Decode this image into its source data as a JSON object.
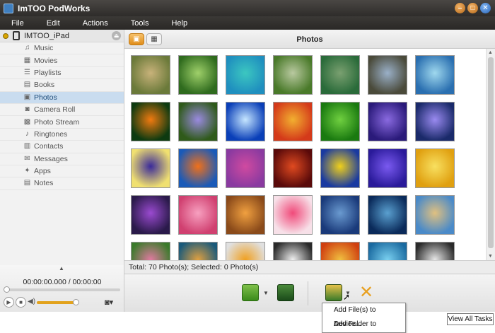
{
  "app": {
    "title": "ImTOO PodWorks"
  },
  "menu": [
    "File",
    "Edit",
    "Actions",
    "Tools",
    "Help"
  ],
  "sidebar": {
    "device_name": "IMTOO_iPad",
    "items": [
      {
        "label": "Music",
        "icon": "music-note-icon"
      },
      {
        "label": "Movies",
        "icon": "film-icon"
      },
      {
        "label": "Playlists",
        "icon": "playlist-icon"
      },
      {
        "label": "Books",
        "icon": "book-icon"
      },
      {
        "label": "Photos",
        "icon": "photo-icon",
        "active": true
      },
      {
        "label": "Camera Roll",
        "icon": "camera-icon"
      },
      {
        "label": "Photo Stream",
        "icon": "photo-stream-icon"
      },
      {
        "label": "Ringtones",
        "icon": "bell-icon"
      },
      {
        "label": "Contacts",
        "icon": "contacts-icon"
      },
      {
        "label": "Messages",
        "icon": "message-icon"
      },
      {
        "label": "Apps",
        "icon": "apps-icon"
      },
      {
        "label": "Notes",
        "icon": "notes-icon"
      }
    ]
  },
  "player": {
    "time": "00:00:00.000 / 00:00:00"
  },
  "main": {
    "title": "Photos",
    "status": "Total: 70 Photo(s); Selected: 0 Photo(s)"
  },
  "photos": [
    {
      "c1": "#6b7a3a",
      "c2": "#c8b27a"
    },
    {
      "c1": "#2f6b1e",
      "c2": "#9fd06a"
    },
    {
      "c1": "#1f8fbf",
      "c2": "#3cc7c0"
    },
    {
      "c1": "#4a7a2a",
      "c2": "#b9c9a0"
    },
    {
      "c1": "#2a6b3a",
      "c2": "#7aa070"
    },
    {
      "c1": "#4a4a3a",
      "c2": "#9ab0c8"
    },
    {
      "c1": "#2a6fb0",
      "c2": "#9fd8ee"
    },
    {
      "c1": "#0d3a10",
      "c2": "#f07a10"
    },
    {
      "c1": "#2f5a1a",
      "c2": "#9a8ae0"
    },
    {
      "c1": "#0a3fb8",
      "c2": "#c6e6ff"
    },
    {
      "c1": "#d43a1a",
      "c2": "#f2b030"
    },
    {
      "c1": "#1a7a10",
      "c2": "#70d040"
    },
    {
      "c1": "#2a1a7a",
      "c2": "#8a6ae0"
    },
    {
      "c1": "#1a2a6a",
      "c2": "#9a8af0"
    },
    {
      "c1": "#f0e070",
      "c2": "#3a2a9a"
    },
    {
      "c1": "#1a5ab8",
      "c2": "#f0701a"
    },
    {
      "c1": "#8a3aa0",
      "c2": "#d04aa0"
    },
    {
      "c1": "#5a0a0a",
      "c2": "#e04a20"
    },
    {
      "c1": "#1a3aa0",
      "c2": "#f0d01a"
    },
    {
      "c1": "#2a1a9a",
      "c2": "#7a5af0"
    },
    {
      "c1": "#e0a010",
      "c2": "#f8e060"
    },
    {
      "c1": "#2a1a4a",
      "c2": "#9a4ad0"
    },
    {
      "c1": "#d04070",
      "c2": "#f7a0c0"
    },
    {
      "c1": "#8a4a1a",
      "c2": "#f0a040"
    },
    {
      "c1": "#f7e0e8",
      "c2": "#f04a7a"
    },
    {
      "c1": "#1a3a7a",
      "c2": "#6a9ad0"
    },
    {
      "c1": "#0a2a5a",
      "c2": "#5aa0d0"
    },
    {
      "c1": "#4a8ac8",
      "c2": "#e0c080"
    },
    {
      "c1": "#3a7a2a",
      "c2": "#e07aa0"
    },
    {
      "c1": "#1a5a7a",
      "c2": "#e0a040"
    },
    {
      "c1": "#e0e0e0",
      "c2": "#f0a020"
    },
    {
      "c1": "#2a2a2a",
      "c2": "#f0f0f0"
    },
    {
      "c1": "#d04010",
      "c2": "#f0c040"
    },
    {
      "c1": "#1a6aa0",
      "c2": "#7ad0f0"
    },
    {
      "c1": "#2a2a2a",
      "c2": "#e8e8e8"
    }
  ],
  "toolbar": {
    "add_to_device_icon": "add-to-device-icon",
    "export_icon": "export-to-pc-icon",
    "add_video_icon": "add-video-icon",
    "delete_icon": "delete-icon"
  },
  "dropdown": [
    "Add File(s) to Device...",
    "Add Folder to Device..."
  ],
  "footer": {
    "view_all": "View All Tasks"
  }
}
